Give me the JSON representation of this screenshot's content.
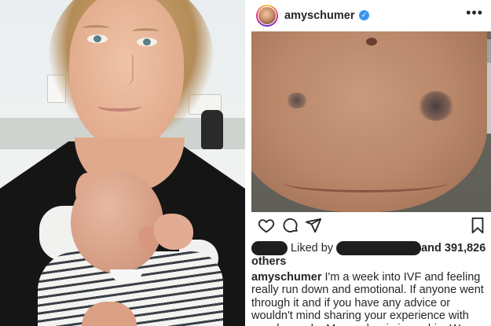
{
  "post": {
    "username": "amyschumer",
    "verified_icon": "verified-badge-icon",
    "more_icon": "more-options-icon",
    "likes": {
      "prefix": "Liked by",
      "and_text": "and 391,826",
      "others_text": "others"
    },
    "caption": {
      "author": "amyschumer",
      "text": "I'm a week into IVF and feeling really run down and emotional. If anyone went through it and if you have any advice or wouldn't mind sharing your experience with me please do. My number is in my bio. We are"
    }
  },
  "actions": {
    "like_icon": "heart-icon",
    "comment_icon": "comment-icon",
    "share_icon": "share-icon",
    "save_icon": "bookmark-icon"
  },
  "colors": {
    "text": "#262626",
    "verified": "#3897f0"
  }
}
